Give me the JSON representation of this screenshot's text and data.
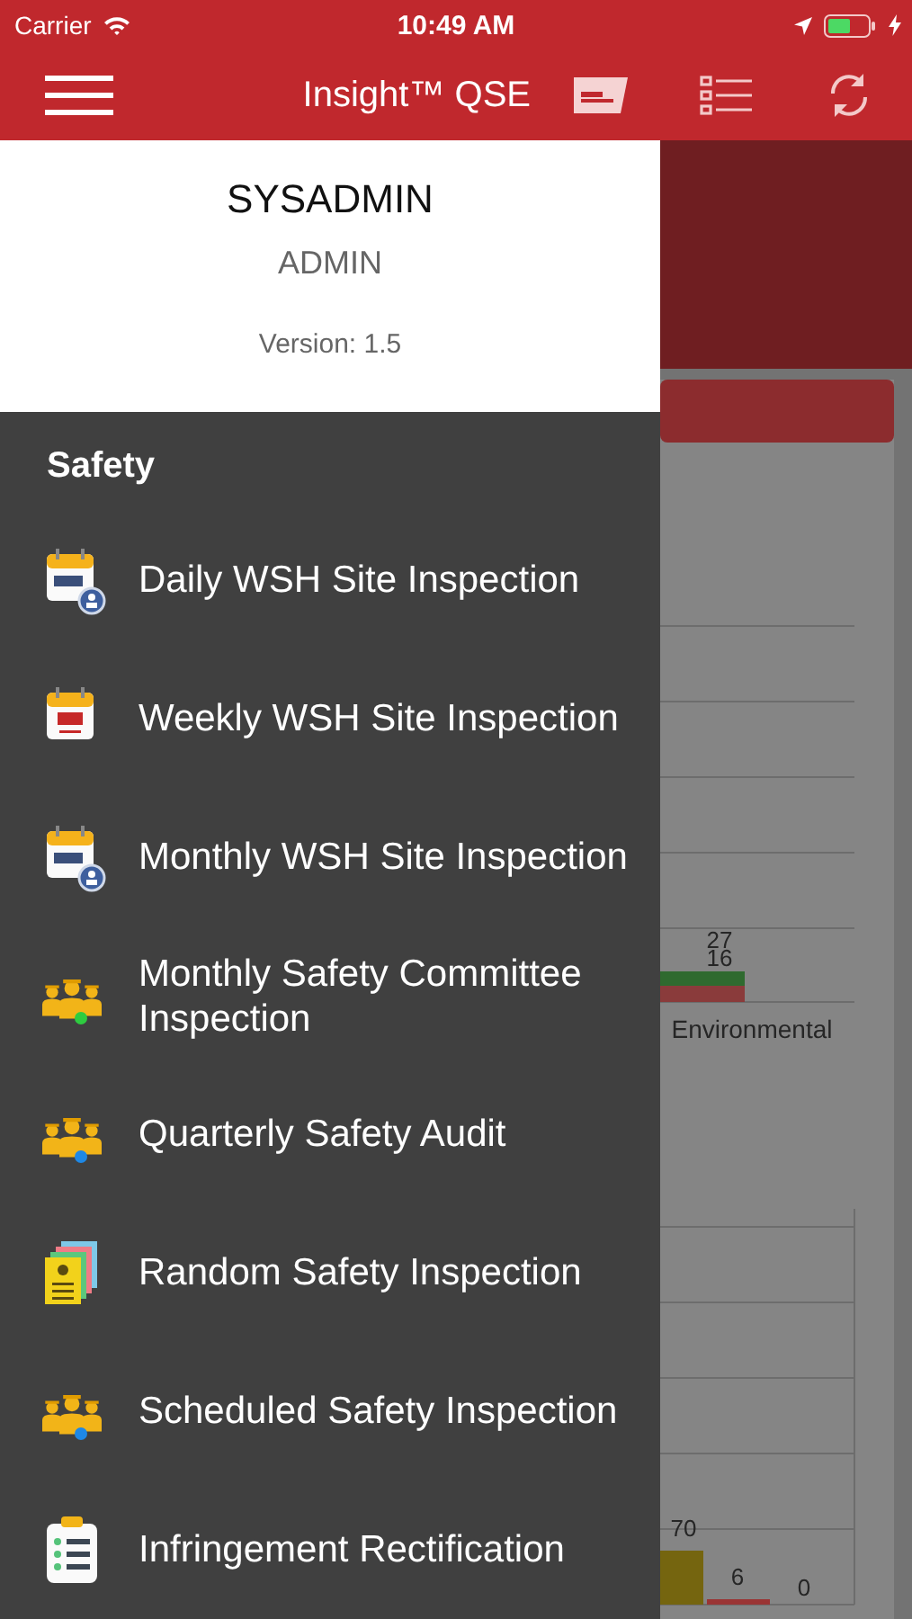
{
  "status_bar": {
    "carrier": "Carrier",
    "time": "10:49 AM"
  },
  "nav_bar": {
    "title": "Insight™ QSE"
  },
  "drawer": {
    "user": "SYSADMIN",
    "role": "ADMIN",
    "version": "Version: 1.5",
    "section": "Safety",
    "items": [
      {
        "label": "Daily WSH Site Inspection",
        "kind": "calendar_badge"
      },
      {
        "label": "Weekly WSH Site Inspection",
        "kind": "calendar"
      },
      {
        "label": "Monthly WSH Site Inspection",
        "kind": "calendar_badge"
      },
      {
        "label": "Monthly Safety Committee Inspection",
        "kind": "team",
        "color": "#2ecc40"
      },
      {
        "label": "Quarterly Safety Audit",
        "kind": "team",
        "color": "#1e88e5"
      },
      {
        "label": "Random Safety Inspection",
        "kind": "documents"
      },
      {
        "label": "Scheduled Safety Inspection",
        "kind": "team",
        "color": "#1e88e5"
      },
      {
        "label": "Infringement Rectification",
        "kind": "clipboard"
      }
    ]
  },
  "dashboard": {
    "issues_chart": {
      "category": "Environmental",
      "bar_labels": [
        "27",
        "16"
      ]
    },
    "inspections_chart": {
      "bar_labels": [
        "70",
        "6",
        "0"
      ]
    }
  }
}
